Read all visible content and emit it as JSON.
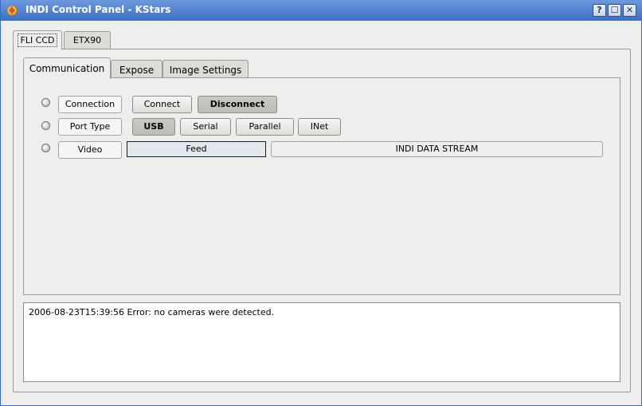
{
  "window": {
    "title": "INDI Control Panel - KStars",
    "help_label": "?",
    "maximize_label": "☐",
    "close_label": "✕",
    "app_icon": "kstars-icon"
  },
  "device_tabs": [
    {
      "label": "FLI CCD",
      "active": true
    },
    {
      "label": "ETX90",
      "active": false
    }
  ],
  "group_tabs": [
    {
      "label": "Communication",
      "active": true
    },
    {
      "label": "Expose",
      "active": false
    },
    {
      "label": "Image Settings",
      "active": false
    }
  ],
  "properties": {
    "connection": {
      "label": "Connection",
      "buttons": [
        "Connect",
        "Disconnect"
      ],
      "selected": "Disconnect"
    },
    "port_type": {
      "label": "Port Type",
      "buttons": [
        "USB",
        "Serial",
        "Parallel",
        "INet"
      ],
      "selected": "USB"
    },
    "video": {
      "label": "Video",
      "element": "Feed",
      "value": "INDI DATA STREAM"
    }
  },
  "log": {
    "text": "2006-08-23T15:39:56 Error: no cameras were detected."
  }
}
